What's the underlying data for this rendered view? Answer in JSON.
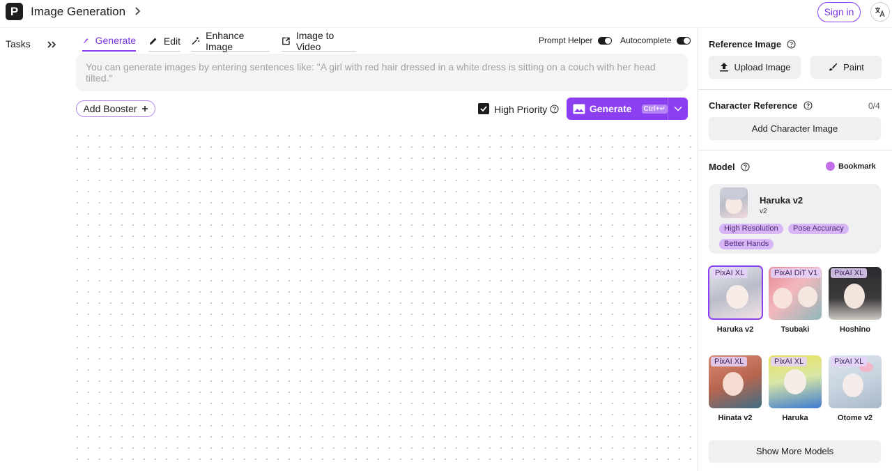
{
  "header": {
    "logo_letter": "P",
    "app_title": "Image Generation",
    "sign_in": "Sign in"
  },
  "sidebar": {
    "tasks_label": "Tasks"
  },
  "tabs": [
    {
      "label": "Generate",
      "active": true,
      "icon": "brush-icon"
    },
    {
      "label": "Edit",
      "active": false,
      "icon": "pencil-icon"
    },
    {
      "label": "Enhance Image",
      "active": false,
      "icon": "magic-wand-icon"
    },
    {
      "label": "Image to Video",
      "active": false,
      "icon": "video-export-icon"
    }
  ],
  "toggles": {
    "prompt_helper": {
      "label": "Prompt Helper",
      "on": true
    },
    "autocomplete": {
      "label": "Autocomplete",
      "on": true
    }
  },
  "prompt": {
    "value": "",
    "placeholder": "You can generate images by entering sentences like: \"A girl with red hair dressed in a white dress is sitting on a couch with her head tilted.\""
  },
  "actions": {
    "add_booster": "Add Booster",
    "high_priority": {
      "label": "High Priority",
      "checked": true
    },
    "generate": {
      "label": "Generate",
      "shortcut": "Ctrl+↵"
    }
  },
  "colors": {
    "accent": "#8c3ff0",
    "tag_bg": "#d7b6f6"
  },
  "right_panel": {
    "reference_image": {
      "title": "Reference Image",
      "upload": "Upload Image",
      "paint": "Paint"
    },
    "character_reference": {
      "title": "Character Reference",
      "count": "0/4",
      "add": "Add Character Image"
    },
    "model": {
      "title": "Model",
      "bookmark": "Bookmark",
      "selected": {
        "name": "Haruka v2",
        "version": "v2",
        "tags": [
          "High Resolution",
          "Pose Accuracy",
          "Better Hands"
        ]
      },
      "grid": [
        {
          "badge": "PixAI XL",
          "name": "Haruka v2",
          "selected": true
        },
        {
          "badge": "PixAI DiT V1",
          "name": "Tsubaki",
          "selected": false
        },
        {
          "badge": "PixAI XL",
          "name": "Hoshino",
          "selected": false
        },
        {
          "badge": "PixAI XL",
          "name": "Hinata v2",
          "selected": false
        },
        {
          "badge": "PixAI XL",
          "name": "Haruka",
          "selected": false
        },
        {
          "badge": "PixAI XL",
          "name": "Otome v2",
          "selected": false
        }
      ],
      "show_more": "Show More Models"
    }
  }
}
